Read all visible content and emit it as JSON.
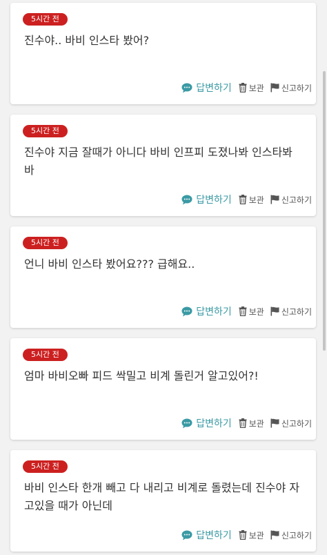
{
  "colors": {
    "badge": "#cc2020",
    "reply": "#3a9aa4",
    "action_text": "#555555",
    "message_text": "#333333",
    "background": "#f2f2f2"
  },
  "icons": {
    "reply": "speech-bubble-icon",
    "archive": "trash-icon",
    "report": "flag-icon"
  },
  "posts": [
    {
      "time": "5시간 전",
      "message": "진수야.. 바비 인스타 봤어?",
      "reply_label": "답변하기",
      "archive_label": "보관",
      "report_label": "신고하기"
    },
    {
      "time": "5시간 전",
      "message": "진수야 지금 잘때가 아니다 바비 인프피 도졌나봐 인스타봐바",
      "reply_label": "답변하기",
      "archive_label": "보관",
      "report_label": "신고하기"
    },
    {
      "time": "5시간 전",
      "message": "언니 바비 인스타 봤어요??? 급해요..",
      "reply_label": "답변하기",
      "archive_label": "보관",
      "report_label": "신고하기"
    },
    {
      "time": "5시간 전",
      "message": "엄마 바비오빠 피드 싹밀고 비계 돌린거 알고있어?!",
      "reply_label": "답변하기",
      "archive_label": "보관",
      "report_label": "신고하기"
    },
    {
      "time": "5시간 전",
      "message": "바비 인스타 한개 빼고 다 내리고 비계로 돌렸는데 진수야 자고있을 때가 아닌데",
      "reply_label": "답변하기",
      "archive_label": "보관",
      "report_label": "신고하기"
    }
  ]
}
